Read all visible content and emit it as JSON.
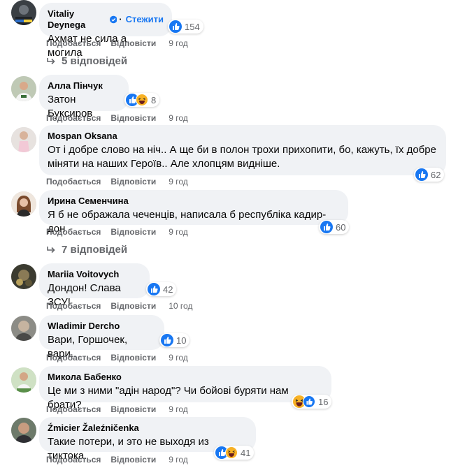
{
  "ui": {
    "follow_label": "Стежити",
    "like_label": "Подобається",
    "reply_label": "Відповісти"
  },
  "comments": [
    {
      "author": "Vitaliy Deynega",
      "verified": true,
      "text": "Ахмат не сила а могила",
      "reactions": "154",
      "reaction_types": [
        "like"
      ],
      "time": "9 год",
      "replies": "5 відповідей"
    },
    {
      "author": "Алла Пінчук",
      "text": "Затон Буксиров",
      "reactions": "8",
      "reaction_types": [
        "like",
        "haha"
      ],
      "time": "9 год"
    },
    {
      "author": "Mospan Oksana",
      "text": "От і добре слово на ніч.. А ще би в полон трохи прихопити, бо, кажуть, їх добре\nміняти на наших Героїв.. Але хлопцям видніше.",
      "reactions": "62",
      "reaction_types": [
        "like"
      ],
      "time": "9 год"
    },
    {
      "author": "Ирина Семенчина",
      "text": "Я б не ображала чеченців, написала б республіка кадир-дон",
      "reactions": "60",
      "reaction_types": [
        "like"
      ],
      "time": "9 год",
      "replies": "7 відповідей"
    },
    {
      "author": "Mariia Voitovych",
      "text": "Дондон! Слава ЗСУ!",
      "reactions": "42",
      "reaction_types": [
        "like"
      ],
      "time": "10 год"
    },
    {
      "author": "Wladimir Dercho",
      "text": "Вари, Горшочек, вари..",
      "reactions": "10",
      "reaction_types": [
        "like"
      ],
      "time": "9 год"
    },
    {
      "author": "Микола Бабенко",
      "text": "Це ми з ними \"адін народ\"? Чи бойові буряти нам брати?",
      "reactions": "16",
      "reaction_types": [
        "haha",
        "like"
      ],
      "time": "9 год"
    },
    {
      "author": "Źmicier Žaleźničenka",
      "text": "Такие потери, и это не выходя из тиктока.",
      "reactions": "41",
      "reaction_types": [
        "like",
        "haha"
      ],
      "time": "9 год"
    }
  ],
  "colors": {
    "accent": "#1877f2",
    "bubble": "#f0f2f5",
    "muted": "#65676b",
    "haha": "#f7b125"
  },
  "icons": [
    "verified-badge-icon",
    "like-reaction-icon",
    "haha-reaction-icon",
    "reply-arrow-icon"
  ]
}
